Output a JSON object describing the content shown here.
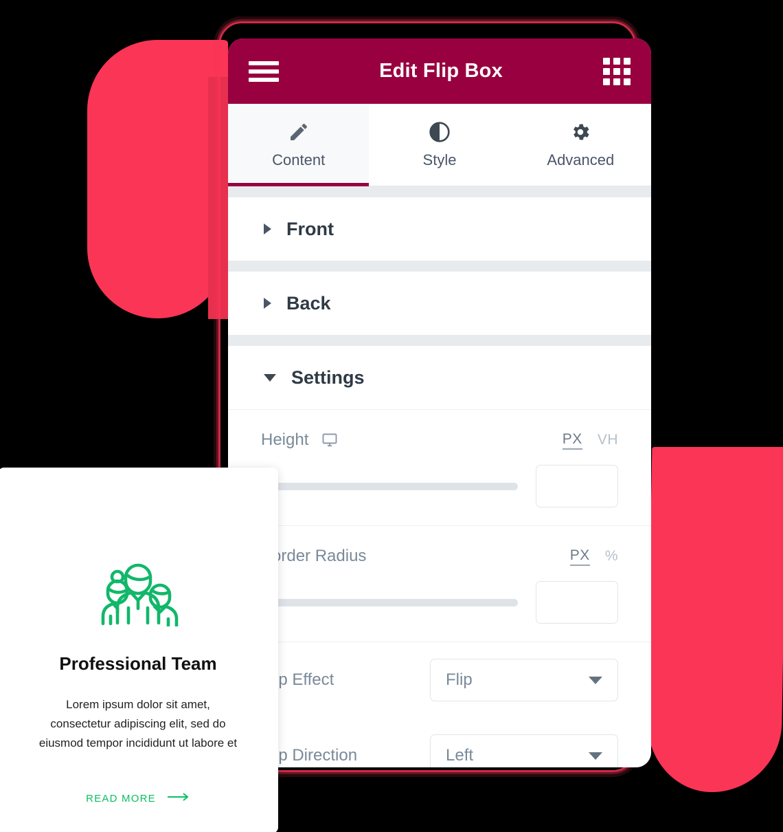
{
  "app": {
    "title": "Edit Flip Box",
    "menu_icon": "hamburger-menu-icon",
    "grid_icon": "app-grid-icon",
    "header_color": "#99003f"
  },
  "tabs": [
    {
      "label": "Content",
      "icon": "pencil-icon",
      "active": true
    },
    {
      "label": "Style",
      "icon": "contrast-circle-icon",
      "active": false
    },
    {
      "label": "Advanced",
      "icon": "gear-icon",
      "active": false
    }
  ],
  "sections": [
    {
      "title": "Front",
      "expanded": false
    },
    {
      "title": "Back",
      "expanded": false
    },
    {
      "title": "Settings",
      "expanded": true
    }
  ],
  "settings": {
    "height": {
      "label": "Height",
      "device_icon": "desktop-monitor-icon",
      "units": [
        {
          "label": "PX",
          "active": true
        },
        {
          "label": "VH",
          "active": false
        }
      ],
      "value": "",
      "slider_fill_percent": 0
    },
    "border_radius": {
      "label": "Border Radius",
      "units": [
        {
          "label": "PX",
          "active": true
        },
        {
          "label": "%",
          "active": false
        }
      ],
      "value": "",
      "slider_fill_percent": 0
    },
    "flip_effect": {
      "label": "Flip Effect",
      "value": "Flip",
      "caret_icon": "chevron-down-icon"
    },
    "flip_direction": {
      "label": "Flip Direction",
      "value": "Left",
      "caret_icon": "chevron-down-icon"
    }
  },
  "preview_card": {
    "icon": "three-people-team-icon",
    "icon_color": "#12b76a",
    "title": "Professional Team",
    "body": "Lorem ipsum dolor sit amet, consectetur adipiscing elit, sed do eiusmod tempor incididunt ut labore et",
    "cta_label": "READ MORE",
    "cta_icon": "arrow-right-icon",
    "cta_color": "#0bbf63"
  },
  "decoration": {
    "blob_color": "#fa3556",
    "blob_shade_color": "#e82f4e",
    "background_color": "#000000"
  }
}
